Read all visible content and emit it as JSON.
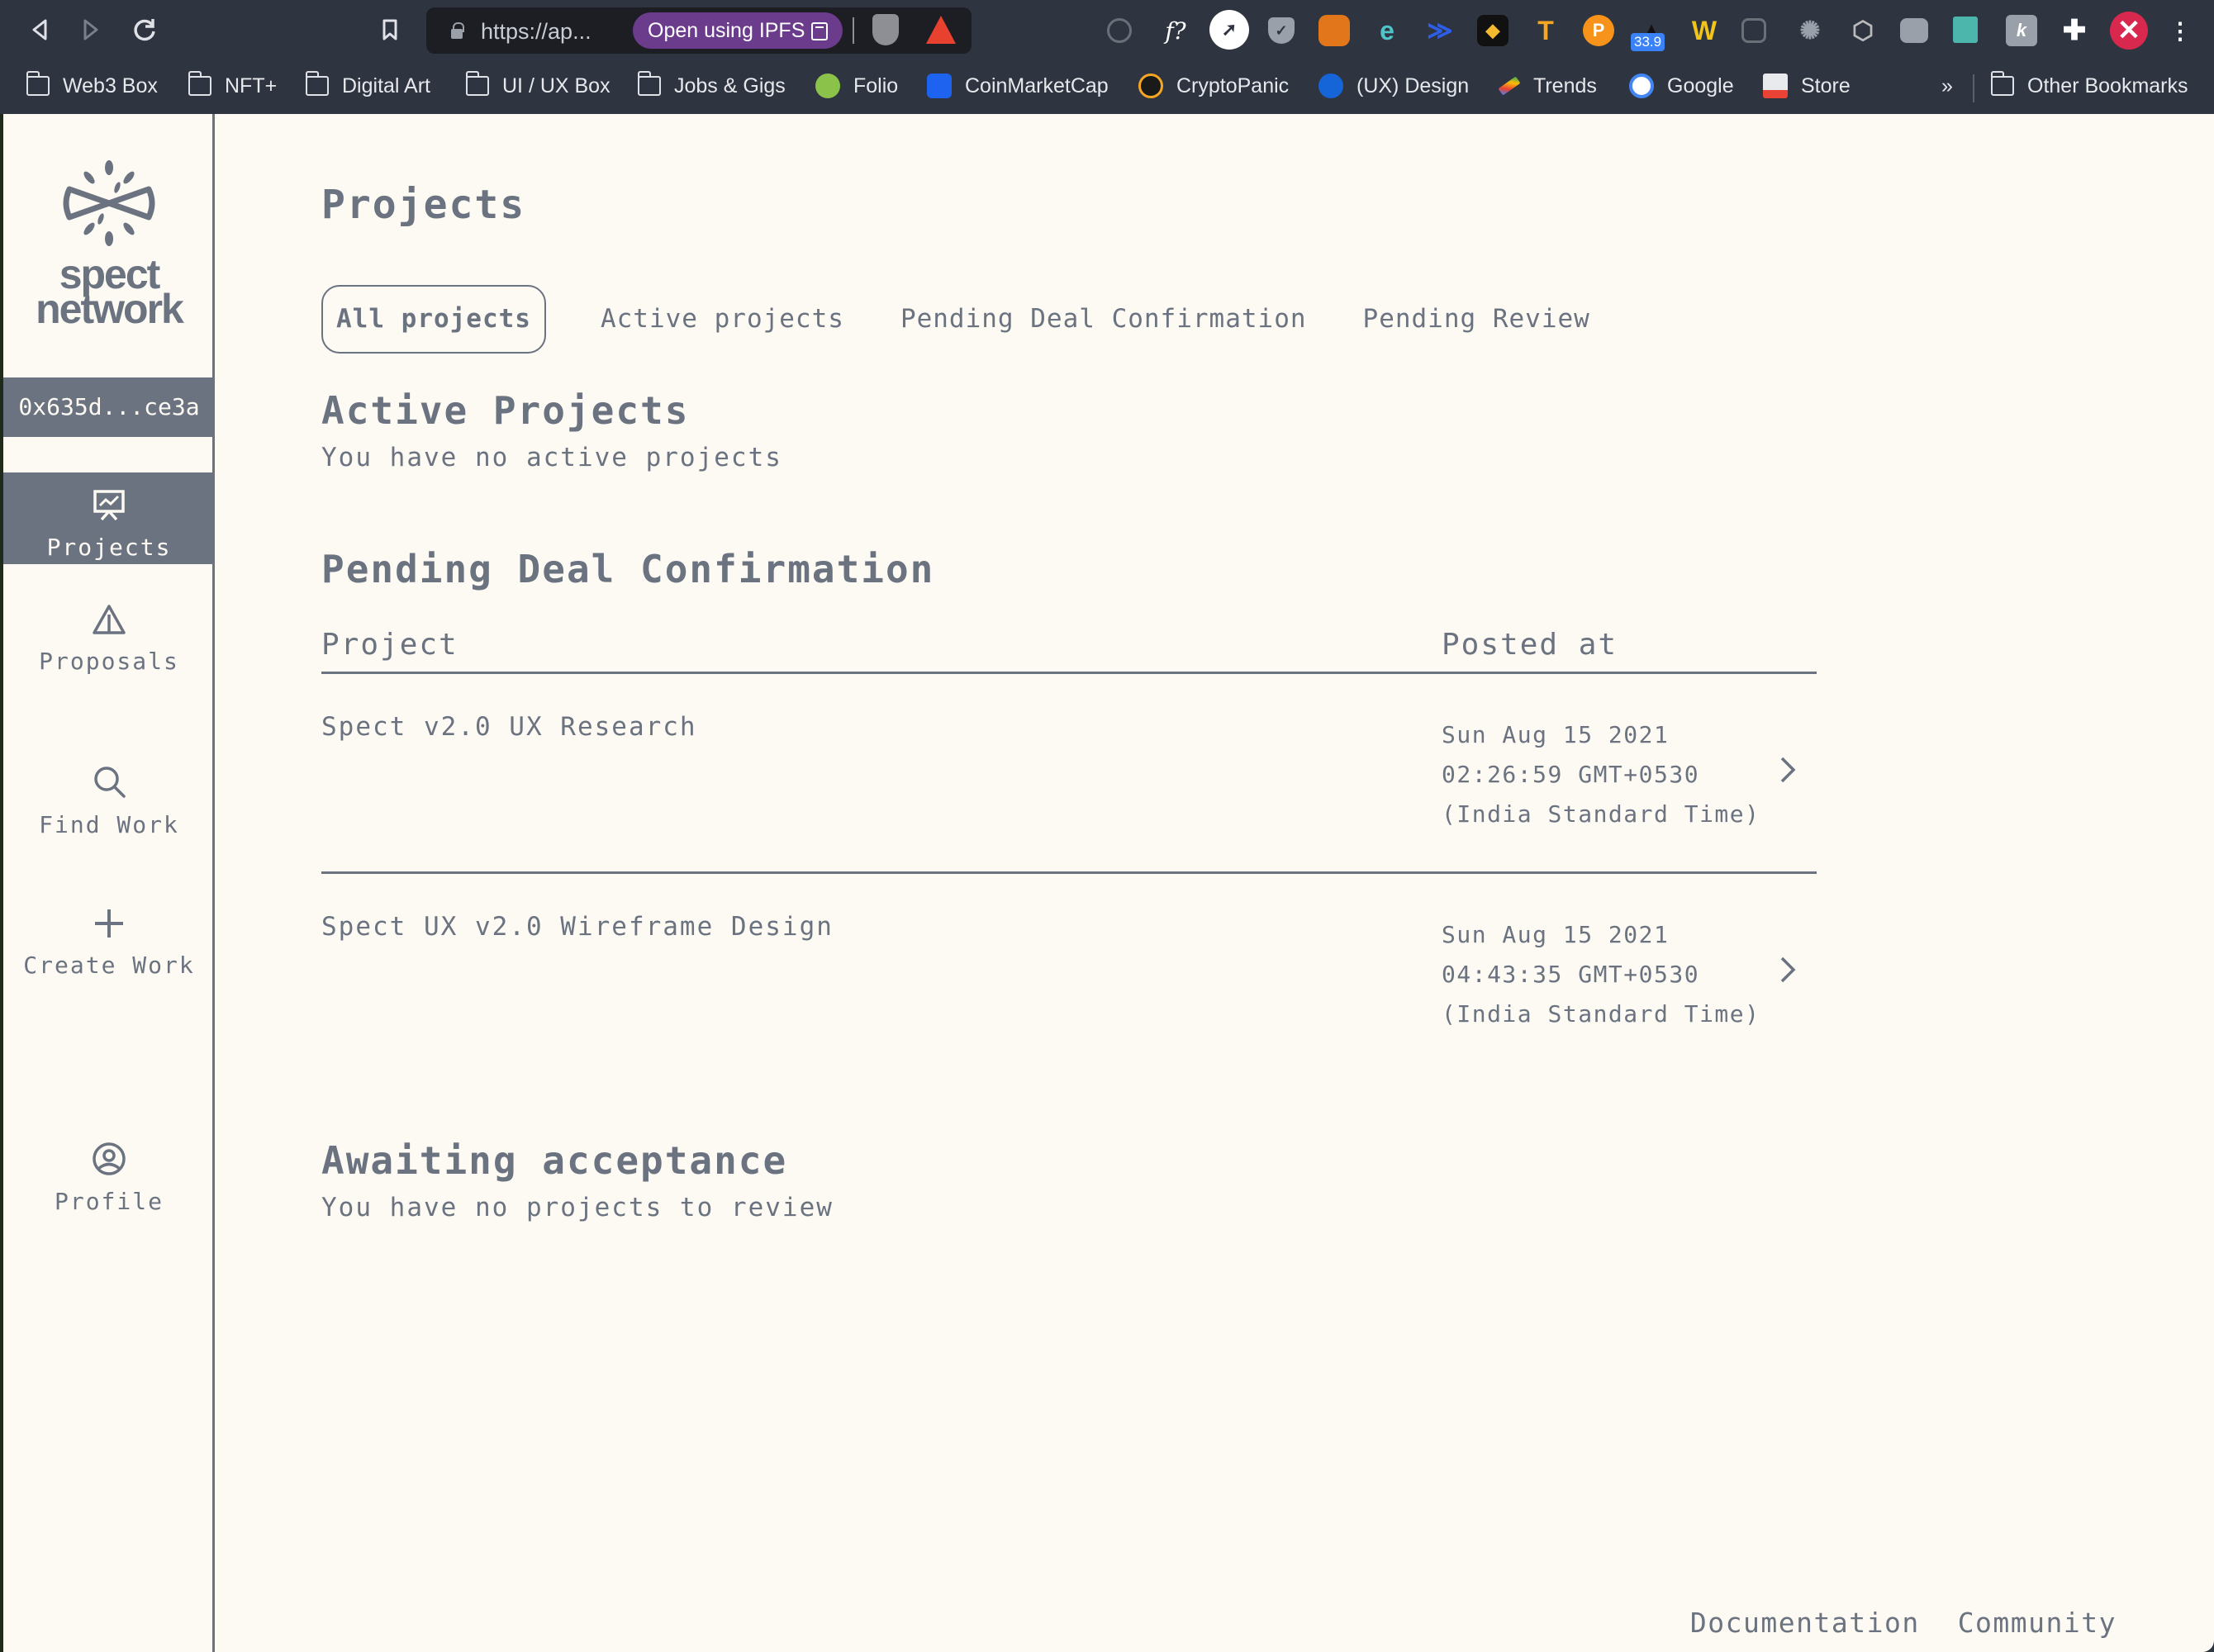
{
  "browser": {
    "url": "https://ap...",
    "ipfs_button": "Open using IPFS",
    "extension_badge": "33.9",
    "bookmarks": [
      {
        "label": "Web3 Box",
        "type": "folder"
      },
      {
        "label": "NFT+",
        "type": "folder"
      },
      {
        "label": "Digital Art",
        "type": "folder"
      },
      {
        "label": "UI / UX Box",
        "type": "folder"
      },
      {
        "label": "Jobs & Gigs",
        "type": "folder"
      },
      {
        "label": "Folio",
        "type": "link",
        "icon_color": "#8bc34a"
      },
      {
        "label": "CoinMarketCap",
        "type": "link",
        "icon_color": "#1e63f0"
      },
      {
        "label": "CryptoPanic",
        "type": "link",
        "icon_color": "#f5a623"
      },
      {
        "label": "(UX) Design",
        "type": "link",
        "icon_color": "#1565d8"
      },
      {
        "label": "Trends",
        "type": "link",
        "icon_color": "#34a853"
      },
      {
        "label": "Google",
        "type": "link",
        "icon_color": "#ffffff"
      },
      {
        "label": "Store",
        "type": "link",
        "icon_color": "#e8eaed"
      }
    ],
    "overflow": "»",
    "other_bookmarks": "Other Bookmarks"
  },
  "sidebar": {
    "logo_line1": "spect",
    "logo_line2": "network",
    "wallet_address": "0x635d...ce3a",
    "items": [
      {
        "label": "Projects",
        "icon": "presentation-chart-icon",
        "active": true
      },
      {
        "label": "Proposals",
        "icon": "paper-plane-icon",
        "active": false
      },
      {
        "label": "Find Work",
        "icon": "search-icon",
        "active": false
      },
      {
        "label": "Create Work",
        "icon": "plus-icon",
        "active": false
      },
      {
        "label": "Profile",
        "icon": "user-circle-icon",
        "active": false
      }
    ]
  },
  "main": {
    "title": "Projects",
    "tabs": [
      {
        "label": "All projects",
        "active": true
      },
      {
        "label": "Active projects",
        "active": false
      },
      {
        "label": "Pending Deal Confirmation",
        "active": false
      },
      {
        "label": "Pending Review",
        "active": false
      }
    ],
    "active_section": {
      "title": "Active Projects",
      "empty_text": "You have no active projects"
    },
    "pending_section": {
      "title": "Pending Deal Confirmation",
      "columns": [
        "Project",
        "Posted at"
      ],
      "rows": [
        {
          "project": "Spect v2.0 UX Research",
          "date_line1": "Sun Aug 15 2021",
          "date_line2": "02:26:59 GMT+0530",
          "date_line3": "(India Standard Time)"
        },
        {
          "project": "Spect UX v2.0 Wireframe Design",
          "date_line1": "Sun Aug 15 2021",
          "date_line2": "04:43:35 GMT+0530",
          "date_line3": "(India Standard Time)"
        }
      ]
    },
    "awaiting_section": {
      "title": "Awaiting acceptance",
      "empty_text": "You have no projects to review"
    }
  },
  "footer": {
    "links": [
      "Documentation",
      "Community"
    ]
  },
  "colors": {
    "app_background": "#fcfaf3",
    "primary_text": "#6b7280",
    "browser_chrome": "#2f3441",
    "ipfs_purple": "#6b3c8c"
  }
}
